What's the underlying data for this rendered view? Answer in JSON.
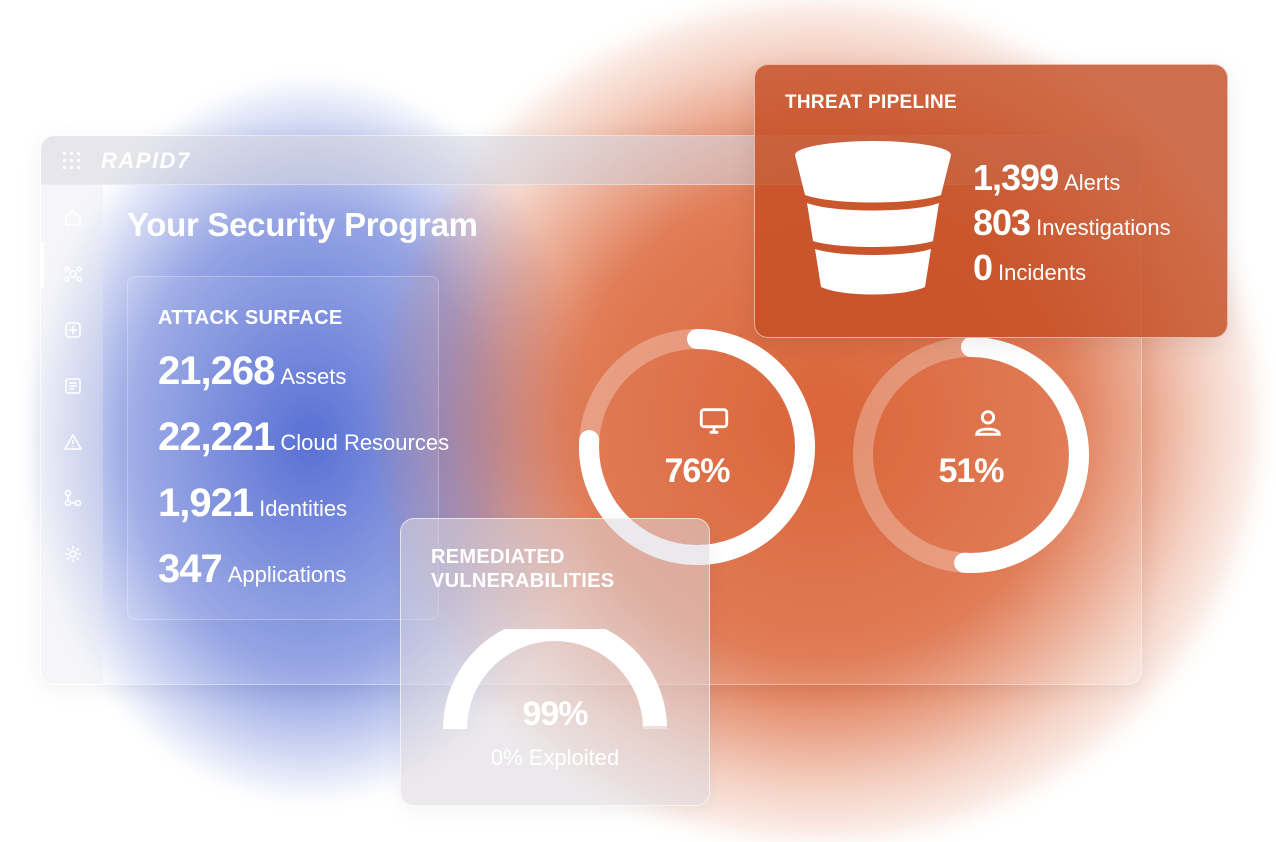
{
  "brand": "RAPID7",
  "page_title": "Your Security Program",
  "sidebar": {
    "items": [
      {
        "icon": "home-icon"
      },
      {
        "icon": "network-icon"
      },
      {
        "icon": "add-box-icon"
      },
      {
        "icon": "document-icon"
      },
      {
        "icon": "alert-icon"
      },
      {
        "icon": "workflow-icon"
      },
      {
        "icon": "settings-icon"
      }
    ]
  },
  "attack_surface": {
    "heading": "ATTACK SURFACE",
    "stats": [
      {
        "value": "21,268",
        "label": "Assets"
      },
      {
        "value": "22,221",
        "label": "Cloud Resources"
      },
      {
        "value": "1,921",
        "label": "Identities"
      },
      {
        "value": "347",
        "label": "Applications"
      }
    ]
  },
  "donuts": [
    {
      "icon": "monitor-icon",
      "percent_label": "76%",
      "fraction": 0.76
    },
    {
      "icon": "user-icon",
      "percent_label": "51%",
      "fraction": 0.51
    }
  ],
  "threat_pipeline": {
    "heading": "THREAT PIPELINE",
    "stats": [
      {
        "value": "1,399",
        "label": "Alerts"
      },
      {
        "value": "803",
        "label": "Investigations"
      },
      {
        "value": "0",
        "label": "Incidents"
      }
    ]
  },
  "remediated": {
    "heading": "REMEDIATED VULNERABILITIES",
    "percent_label": "99%",
    "fraction": 0.99,
    "subtext": "0% Exploited"
  },
  "colors": {
    "blue_glow": "#2846c8",
    "orange_glow": "#d6501e",
    "card_orange": "#c44e24",
    "text": "#ffffff"
  }
}
